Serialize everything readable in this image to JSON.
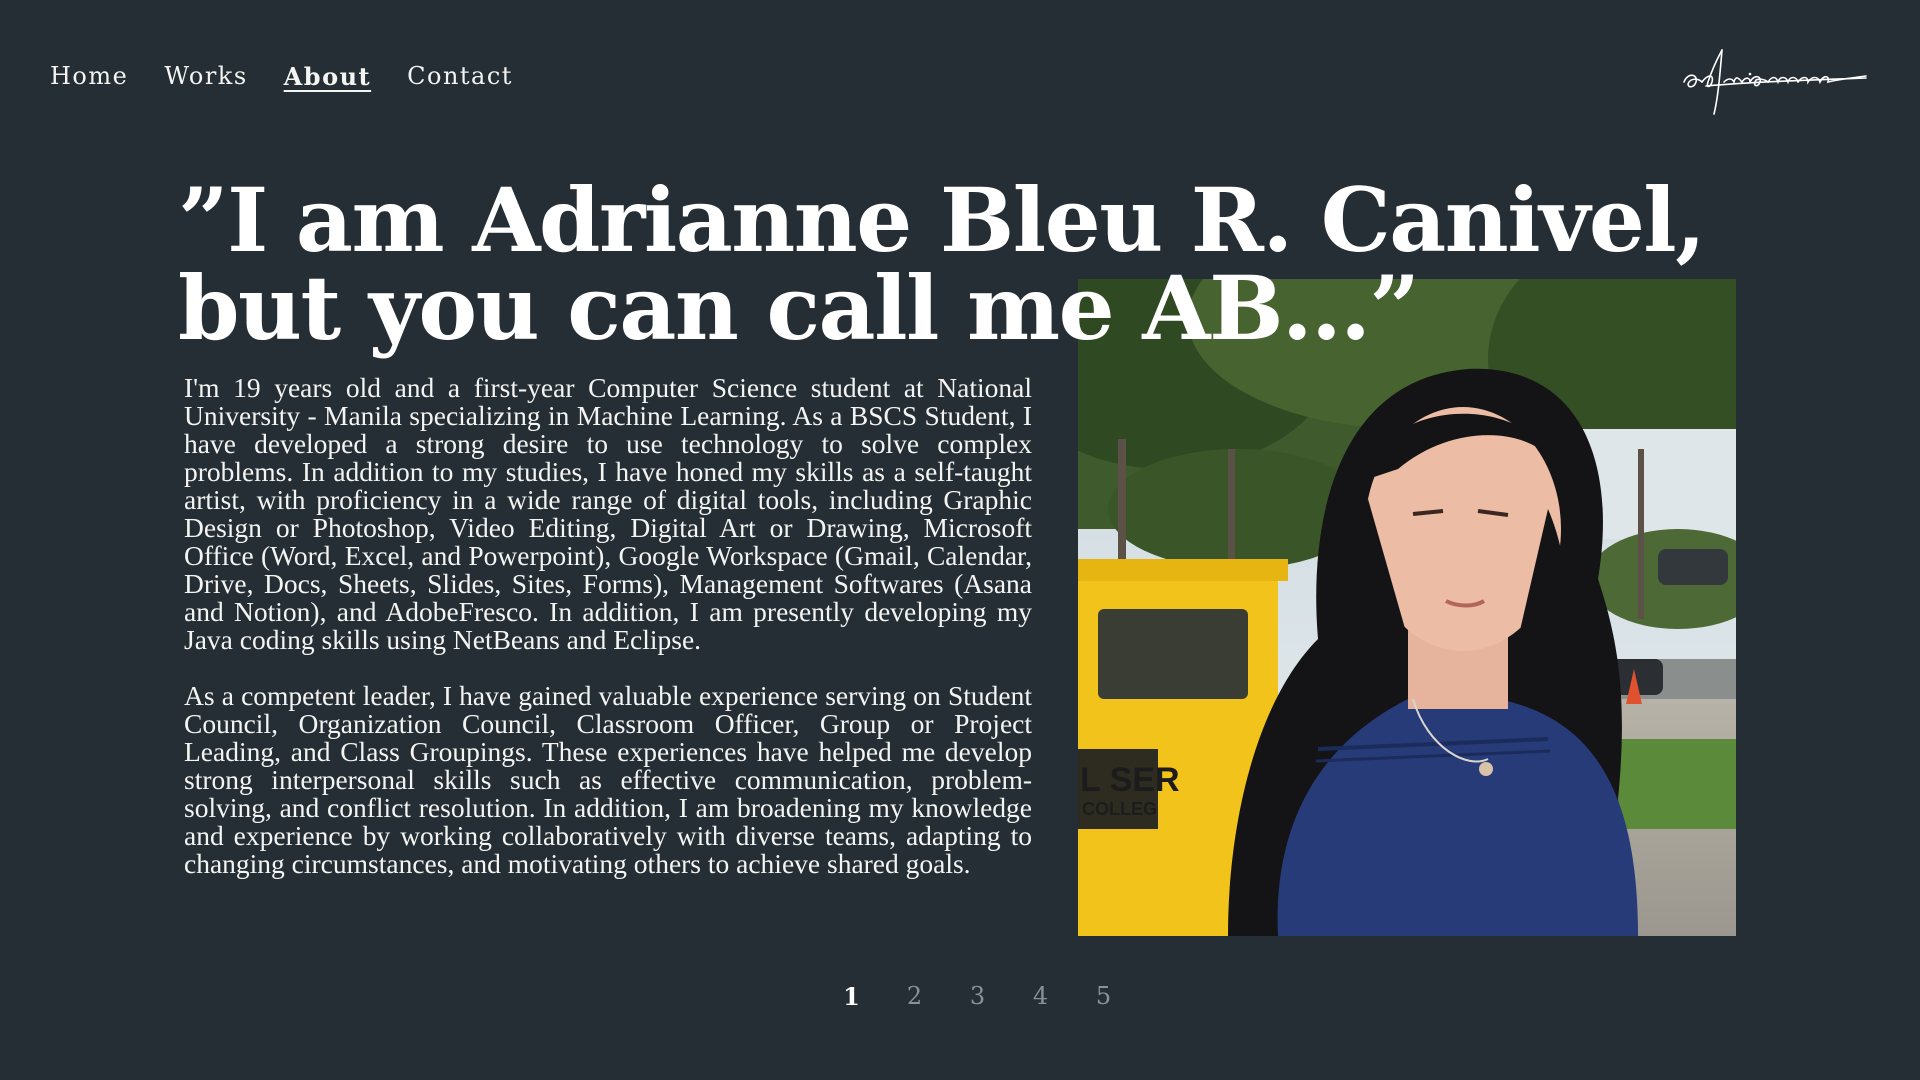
{
  "nav": {
    "items": [
      {
        "label": "Home"
      },
      {
        "label": "Works"
      },
      {
        "label": "About",
        "active": true
      },
      {
        "label": "Contact"
      }
    ]
  },
  "logo": {
    "text": "adrianne"
  },
  "hero": {
    "line1": "”I am Adrianne Bleu R. Canivel,",
    "line2": "but you can call me AB...”"
  },
  "bio": {
    "p1": "I'm 19 years old and a first-year Computer Science student at National University - Manila specializing in Machine Learning. As a BSCS Student, I have developed a strong desire to use technology to solve complex problems. In addition to my studies, I have honed my skills as a self-taught artist, with proficiency in a wide range of digital tools, including Graphic Design or Photoshop, Video Editing, Digital Art or Drawing, Microsoft Office (Word, Excel, and Powerpoint), Google Workspace (Gmail, Calendar, Drive, Docs, Sheets, Slides, Sites, Forms), Management Softwares (Asana and Notion), and AdobeFresco. In addition, I am presently developing my Java coding skills using NetBeans and Eclipse.",
    "p2": "As a competent leader, I have gained valuable experience serving on Student Council, Organization Council, Classroom Officer, Group or Project Leading, and Class Groupings. These experiences have helped me develop strong interpersonal skills such as effective communication, problem-solving, and conflict resolution. In addition, I am broadening my knowledge and experience by working collaboratively with diverse teams, adapting to changing circumstances, and motivating others to achieve shared goals."
  },
  "photo": {
    "bus_text_1": "L SER",
    "bus_text_2": "COLLEG"
  },
  "pagination": {
    "pages": [
      "1",
      "2",
      "3",
      "4",
      "5"
    ],
    "current": "1"
  },
  "colors": {
    "background": "#252e35",
    "text": "#f4f4f2",
    "inactive_page": "#8a9298"
  }
}
